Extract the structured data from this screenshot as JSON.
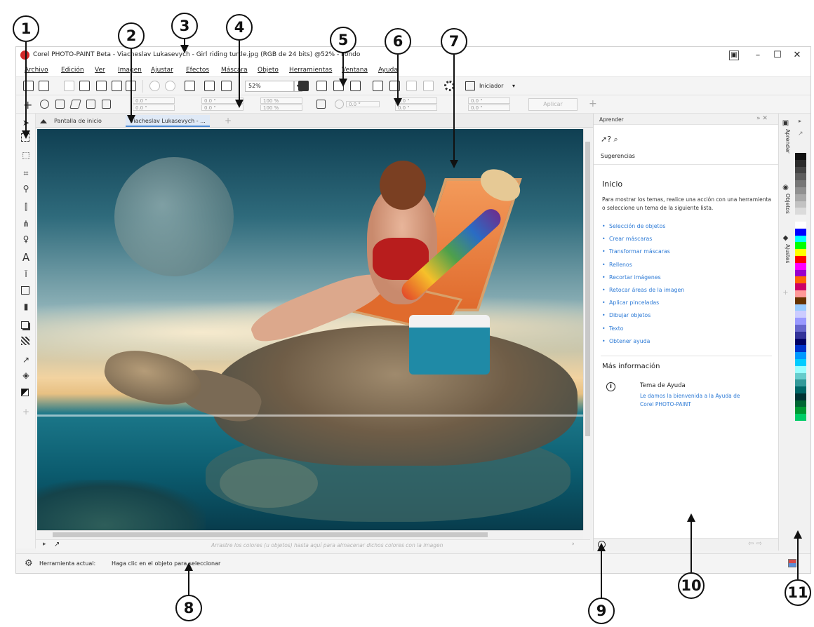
{
  "window": {
    "title": "Corel PHOTO-PAINT Beta - Viacheslav Lukasevych - Girl riding turtle.jpg (RGB de 24 bits) @52% - Fondo",
    "controls": {
      "minimize": "–",
      "maximize": "☐",
      "close": "✕"
    }
  },
  "menubar": {
    "items": [
      "Archivo",
      "Edición",
      "Ver",
      "Imagen",
      "Ajustar",
      "Efectos",
      "Máscara",
      "Objeto",
      "Herramientas",
      "Ventana",
      "Ayuda"
    ]
  },
  "toolbar": {
    "zoom": "52%",
    "zoom_dropdown": "▾",
    "launcher_label": "Iniciador"
  },
  "propertybar": {
    "fields": [
      "0.0 \"",
      "0.0 \"",
      "0.0 \"",
      "0.0 \"",
      "100 %",
      "100 %",
      "0.0 °",
      "0.0 \"",
      "0.0 \"",
      "0.0 \"",
      "0.0 \""
    ],
    "apply_label": "Aplicar",
    "add_label": "+"
  },
  "tabs": {
    "home": "Pantalla de inicio",
    "document": "Viacheslav Lukasevych - ...",
    "add": "+"
  },
  "colorbar": {
    "hint": "Arrastre los colores (u objetos) hasta aquí para almacenar dichos colores con la imagen"
  },
  "statusbar": {
    "label": "Herramienta actual:",
    "hint": "Haga clic en el objeto para seleccionar"
  },
  "docker": {
    "title": "Aprender",
    "suggestions_label": "Sugerencias",
    "section_title": "Inicio",
    "description": "Para mostrar los temas, realice una acción con una herramienta o seleccione un tema de la siguiente lista.",
    "topics": [
      "Selección de objetos",
      "Crear máscaras",
      "Transformar máscaras",
      "Rellenos",
      "Recortar imágenes",
      "Retocar áreas de la imagen",
      "Aplicar pinceladas",
      "Dibujar objetos",
      "Texto",
      "Obtener ayuda"
    ],
    "more_title": "Más información",
    "help_topic_title": "Tema de Ayuda",
    "help_topic_link": "Le damos la bienvenida a la Ayuda de Corel PHOTO-PAINT"
  },
  "docker_tabs": [
    "Aprender",
    "Objetos",
    "Ajustes"
  ],
  "palette_colors": [
    "#111111",
    "#2b2b2b",
    "#444444",
    "#5e5e5e",
    "#777777",
    "#909090",
    "#a9a9a9",
    "#c2c2c2",
    "#dbdbdb",
    "#f2f2f2",
    "#ffffff",
    "#0000ff",
    "#00ffff",
    "#00ff00",
    "#ffff00",
    "#ff0000",
    "#ff00ff",
    "#9900cc",
    "#ff6600",
    "#cc0066",
    "#ff9999",
    "#663300",
    "#99ccff",
    "#ccccff",
    "#9999ff",
    "#6666cc",
    "#333399",
    "#000066",
    "#0033cc",
    "#0099ff",
    "#00ccff",
    "#99ffff",
    "#66cccc",
    "#339999",
    "#006666",
    "#003333",
    "#006633",
    "#009933",
    "#00cc66"
  ],
  "callouts": [
    "1",
    "2",
    "3",
    "4",
    "5",
    "6",
    "7",
    "8",
    "9",
    "10",
    "11"
  ]
}
